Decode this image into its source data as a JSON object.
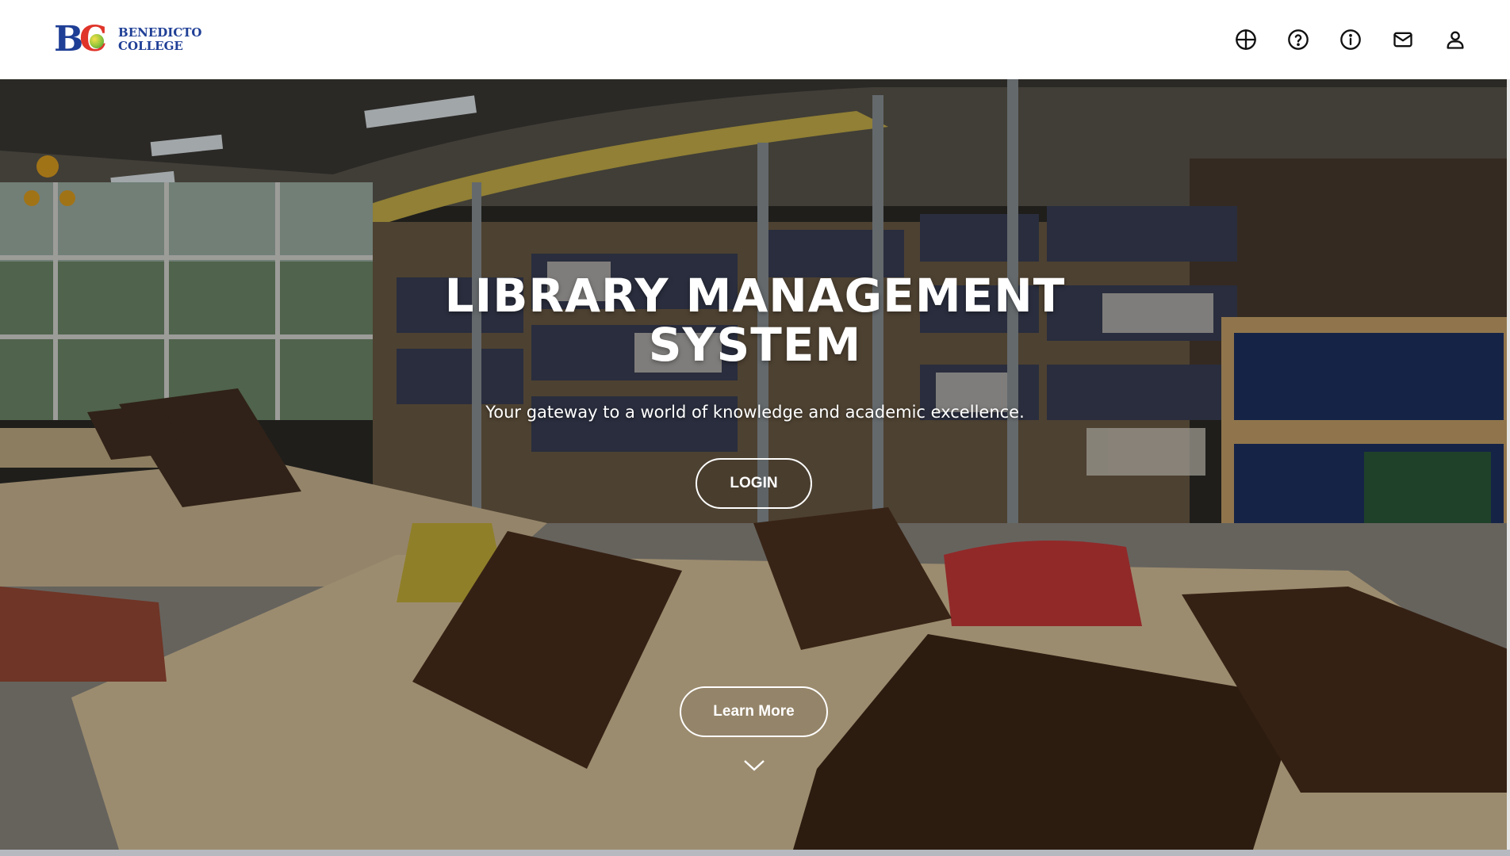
{
  "header": {
    "logo_mark": "BC",
    "logo_line1": "Benedicto",
    "logo_line2": "College",
    "icons": [
      "globe-icon",
      "help-icon",
      "info-icon",
      "mail-icon",
      "user-icon"
    ]
  },
  "hero": {
    "title": "LIBRARY MANAGEMENT SYSTEM",
    "subtitle": "Your gateway to a world of knowledge and academic excellence.",
    "login_label": "LOGIN",
    "learn_more_label": "Learn More"
  },
  "colors": {
    "brand_blue": "#1f3f96",
    "brand_red": "#e0342a",
    "hero_text": "#ffffff"
  }
}
